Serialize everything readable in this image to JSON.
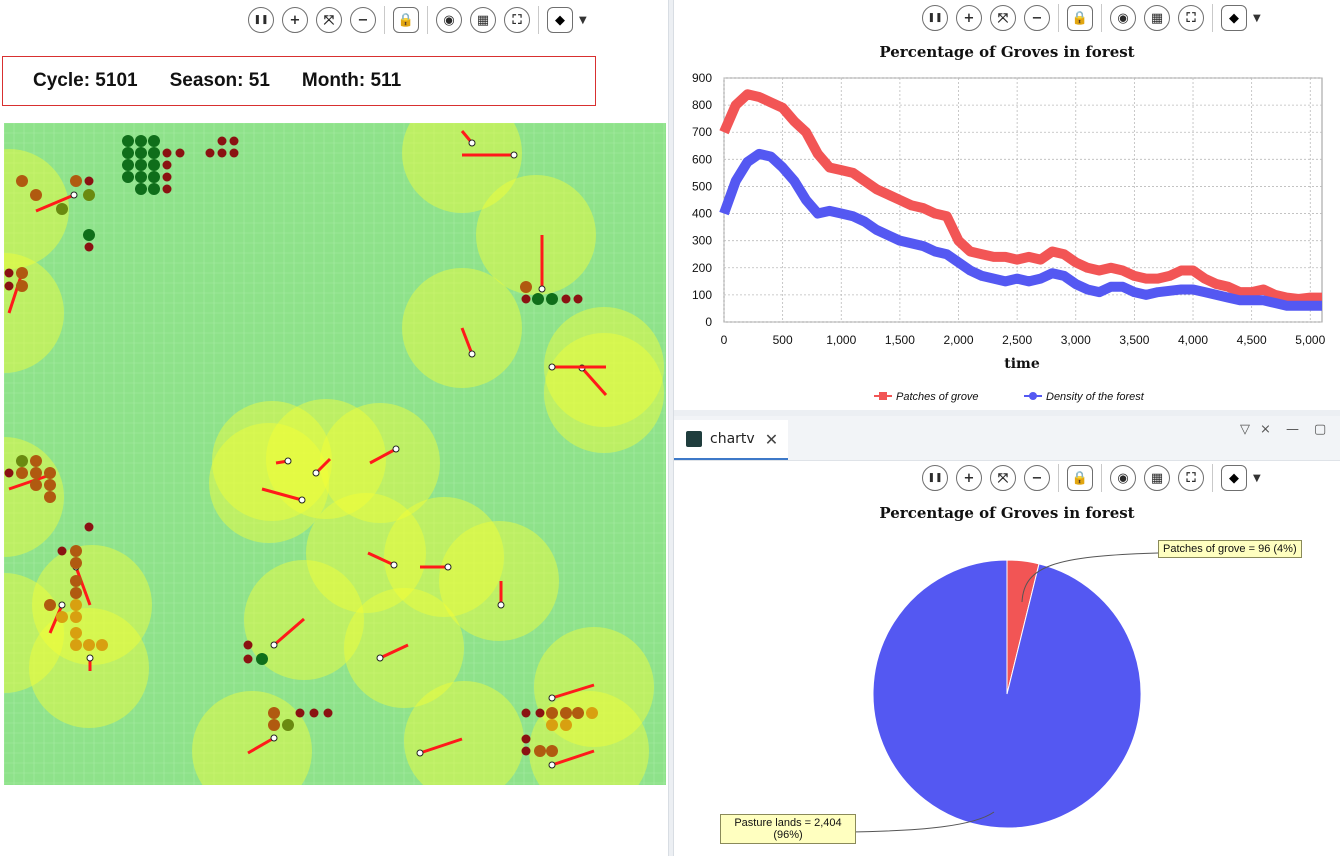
{
  "status": {
    "cycle": "Cycle: 5101",
    "season": "Season: 51",
    "month": "Month: 511"
  },
  "toolbar_icons": [
    "pause-icon",
    "zoom-in-icon",
    "zoom-fit-icon",
    "zoom-out-icon",
    "lock-icon",
    "snapshot-icon",
    "texture-icon",
    "fullscreen-icon",
    "layers-icon"
  ],
  "line_chart": {
    "chart_data": {
      "type": "line",
      "title": "Percentage of Groves in forest",
      "xlabel": "time",
      "ylabel": "",
      "xlim": [
        0,
        5100
      ],
      "ylim": [
        0,
        900
      ],
      "x_ticks": [
        "0",
        "500",
        "1,000",
        "1,500",
        "2,000",
        "2,500",
        "3,000",
        "3,500",
        "4,000",
        "4,500",
        "5,000"
      ],
      "y_ticks": [
        "0",
        "100",
        "200",
        "300",
        "400",
        "500",
        "600",
        "700",
        "800",
        "900"
      ],
      "legend_position": "bottom",
      "grid": true,
      "series": [
        {
          "name": "Patches of grove",
          "color": "#f25555",
          "x": [
            0,
            100,
            200,
            300,
            400,
            500,
            600,
            700,
            800,
            900,
            1000,
            1100,
            1200,
            1300,
            1400,
            1500,
            1600,
            1700,
            1800,
            1900,
            2000,
            2100,
            2200,
            2300,
            2400,
            2500,
            2600,
            2700,
            2800,
            2900,
            3000,
            3100,
            3200,
            3300,
            3400,
            3500,
            3600,
            3700,
            3800,
            3900,
            4000,
            4100,
            4200,
            4300,
            4400,
            4500,
            4600,
            4700,
            4800,
            4900,
            5000,
            5100
          ],
          "values": [
            700,
            800,
            840,
            830,
            810,
            790,
            740,
            700,
            620,
            570,
            560,
            550,
            520,
            490,
            470,
            450,
            430,
            420,
            400,
            390,
            300,
            260,
            250,
            240,
            240,
            230,
            240,
            230,
            260,
            250,
            220,
            200,
            190,
            200,
            190,
            170,
            160,
            160,
            170,
            190,
            190,
            160,
            140,
            130,
            110,
            110,
            120,
            100,
            90,
            85,
            90,
            90
          ]
        },
        {
          "name": "Density of the forest",
          "color": "#5458f2",
          "x": [
            0,
            100,
            200,
            300,
            400,
            500,
            600,
            700,
            800,
            900,
            1000,
            1100,
            1200,
            1300,
            1400,
            1500,
            1600,
            1700,
            1800,
            1900,
            2000,
            2100,
            2200,
            2300,
            2400,
            2500,
            2600,
            2700,
            2800,
            2900,
            3000,
            3100,
            3200,
            3300,
            3400,
            3500,
            3600,
            3700,
            3800,
            3900,
            4000,
            4100,
            4200,
            4300,
            4400,
            4500,
            4600,
            4700,
            4800,
            4900,
            5000,
            5100
          ],
          "values": [
            400,
            520,
            590,
            620,
            610,
            570,
            520,
            450,
            400,
            410,
            400,
            390,
            370,
            340,
            320,
            300,
            290,
            280,
            260,
            250,
            220,
            190,
            170,
            160,
            150,
            160,
            150,
            160,
            180,
            170,
            140,
            120,
            110,
            130,
            130,
            110,
            100,
            110,
            115,
            120,
            120,
            110,
            100,
            90,
            80,
            80,
            80,
            70,
            60,
            60,
            60,
            60
          ]
        }
      ]
    }
  },
  "pie_tab": {
    "label": "chartv",
    "close": "✕"
  },
  "window_controls": [
    "▽",
    "⨯",
    "—",
    "▢"
  ],
  "pie_chart": {
    "chart_data": {
      "type": "pie",
      "title": "Percentage of Groves in forest",
      "slices": [
        {
          "name": "Patches of grove",
          "value": 96,
          "percent": 4,
          "color": "#f25555",
          "label": "Patches of grove = 96 (4%)"
        },
        {
          "name": "Pasture lands",
          "value": 2404,
          "percent": 96,
          "color": "#5458f2",
          "label_line1": "Pasture lands = 2,404",
          "label_line2": "(96%)"
        }
      ]
    }
  }
}
